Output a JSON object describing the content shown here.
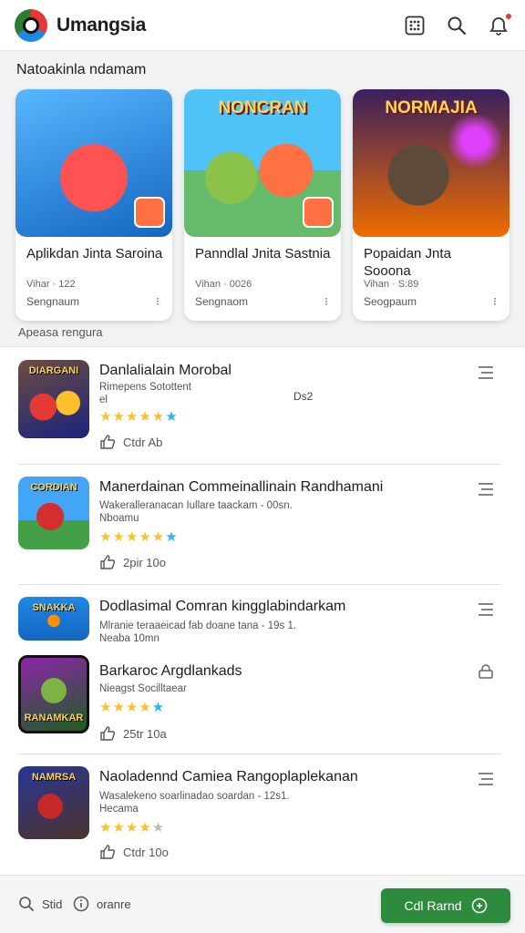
{
  "header": {
    "title": "Umangsia"
  },
  "featured": {
    "section_title": "Natoakinla ndamam",
    "cards": [
      {
        "art_label": "",
        "name": "Aplikdan Jinta Saroina",
        "meta": "Vihar · 122",
        "developer": "Sengnaum",
        "more": "⁝"
      },
      {
        "art_label": "NONCRAN",
        "name": "Panndlal Jnita Sastnia",
        "meta": "Vihan · 0026",
        "developer": "Sengnaom",
        "more": "⁝"
      },
      {
        "art_label": "NORMAJIA",
        "name": "Popaidan Jnta Sooona",
        "meta": "Vihan · S:89",
        "developer": "Seogpaum",
        "more": "⁝"
      }
    ]
  },
  "list_title": "Apeasa rengura",
  "apps": [
    {
      "thumb_label": "DIARGANI",
      "name": "Danlalialain Morobal",
      "sub1": "Rimepens Sotottent",
      "sub2": "el",
      "side_text": "Ds2",
      "stars": "★★★★★",
      "star_tail": "★",
      "stat": "Ctdr  Ab"
    },
    {
      "thumb_label": "CORDIAN",
      "name": "Manerdainan Commeinallinain Randhamani",
      "sub1": "Wakeralleranacan Iullare taackam - 00sn.",
      "sub2": "Nboamu",
      "stars": "★★★★★",
      "star_tail": "★",
      "stat": "2pir  10o"
    },
    {
      "thumb_label": "SNAKKA",
      "name": "Dodlasimal Comran kingglabindarkam",
      "sub1": "Mlranie teraaeicad fab doane tana - 19s 1.",
      "sub2": "Neaba  10mn",
      "stars": "",
      "star_tail": "",
      "stat": ""
    },
    {
      "thumb_label": "RANAMKAR",
      "name": "Barkaroc Argdlankads",
      "sub1": "Nieagst Socilltaear",
      "sub2": "",
      "stars": "★★★★",
      "star_tail": "★",
      "stat": "25tr  10a"
    },
    {
      "thumb_label": "NAMRSA",
      "name": "Naoladennd Camiea Rangoplaplekanan",
      "sub1": "Wasalekeno soarlinadao soardan - 12s1.",
      "sub2": "Hecama",
      "stars": "★★★★",
      "star_tail": "★",
      "stat": "Ctdr  10o"
    }
  ],
  "bottom": {
    "nav1": "Stid",
    "nav2": "oranre",
    "cta": "Cdl Rarnd"
  },
  "colors": {
    "accent": "#2e8b3e",
    "star": "#fbc02d",
    "notification": "#e53935"
  }
}
